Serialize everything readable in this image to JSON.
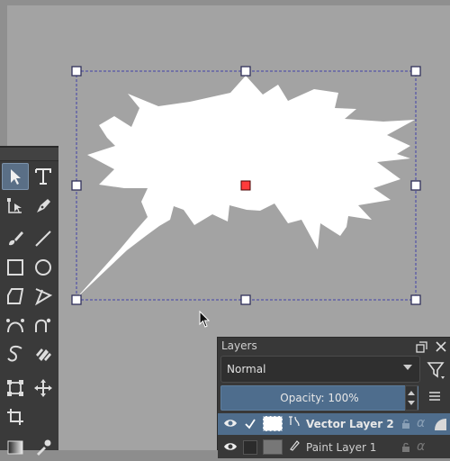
{
  "app": {
    "accent_color": "#4e6d8d",
    "canvas_color": "#a3a3a3",
    "shape_fill": "#ffffff",
    "selection_color": "#3b3b9b",
    "handle_center_color": "#ff3b3b"
  },
  "canvas": {
    "shape_name": "speech-bubble-burst",
    "selection": "active"
  },
  "toolbox": {
    "tools": [
      {
        "name": "select-shape-tool-icon",
        "active": true
      },
      {
        "name": "text-tool-icon",
        "active": false
      },
      {
        "name": "edit-shapes-tool-icon",
        "active": false
      },
      {
        "name": "calligraphy-tool-icon",
        "active": false
      },
      {
        "name": "freehand-brush-tool-icon",
        "active": false
      },
      {
        "name": "line-tool-icon",
        "active": false
      },
      {
        "name": "rectangle-tool-icon",
        "active": false
      },
      {
        "name": "ellipse-tool-icon",
        "active": false
      },
      {
        "name": "polygon-tool-icon",
        "active": false
      },
      {
        "name": "polyline-tool-icon",
        "active": false
      },
      {
        "name": "bezier-curve-tool-icon",
        "active": false
      },
      {
        "name": "freehand-path-tool-icon",
        "active": false
      },
      {
        "name": "dynamic-brush-tool-icon",
        "active": false
      },
      {
        "name": "multibrush-tool-icon",
        "active": false
      },
      {
        "name": "transform-tool-icon",
        "active": false
      },
      {
        "name": "move-tool-icon",
        "active": false
      },
      {
        "name": "crop-tool-icon",
        "active": false
      },
      {
        "name": "gradient-tool-icon",
        "active": false
      },
      {
        "name": "color-picker-tool-icon",
        "active": false
      }
    ]
  },
  "layers": {
    "title": "Layers",
    "blend_mode": "Normal",
    "opacity_label": "Opacity:  100%",
    "opacity": 1.0,
    "items": [
      {
        "name": "Vector Layer 2",
        "selected": true,
        "visible": true,
        "type": "vector"
      },
      {
        "name": "Paint Layer 1",
        "selected": false,
        "visible": true,
        "type": "paint"
      }
    ]
  }
}
